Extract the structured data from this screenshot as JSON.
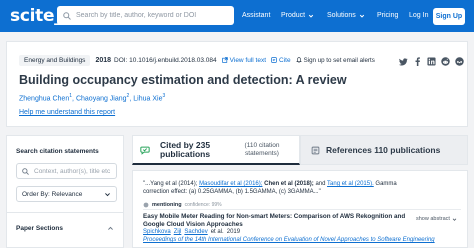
{
  "brand": {
    "logo": "scite_"
  },
  "search": {
    "placeholder": "Search by title, author, keyword or DOI"
  },
  "nav": {
    "assistant": "Assistant",
    "product": "Product",
    "solutions": "Solutions",
    "pricing": "Pricing",
    "login": "Log In",
    "signup": "Sign Up"
  },
  "paper": {
    "journal": "Energy and Buildings",
    "year": "2018",
    "doi": "DOI: 10.1016/j.enbuild.2018.03.084",
    "view_full_text": "View full text",
    "cite": "Cite",
    "alert": "Sign up to set email alerts",
    "share_icons": [
      "twitter-icon",
      "facebook-icon",
      "linkedin-icon",
      "reddit-icon",
      "mendeley-icon"
    ],
    "title": "Building occupancy estimation and detection: A review",
    "authors": [
      {
        "name": "Zhenghua Chen",
        "sup": "1"
      },
      {
        "name": "Chaoyang Jiang",
        "sup": "2"
      },
      {
        "name": "Lihua Xie",
        "sup": "3"
      }
    ],
    "help_link": "Help me understand this report"
  },
  "sidebar": {
    "heading": "Search citation statements",
    "search_placeholder": "Context, author(s), title etc",
    "order_by": "Order By: Relevance",
    "section_heading": "Paper Sections"
  },
  "citations": {
    "cited_by": "Cited by 235 publications",
    "statements": "(110 citation statements)",
    "references": "References 110 publications"
  },
  "statement": {
    "pre": "\"...Yang et al (2014);",
    "ref1": "Masoudifar et al (2016);",
    "highlight": "Chen et al (2018);",
    "mid": "and",
    "ref2": "Tang et al (2015).",
    "post": "Gamma correction effect: (a) 0.25GAMMA, (b) 1.5GAMMA, (c) 3GAMMA...\"",
    "mention_label": "mentioning",
    "confidence": "confidence: 99%",
    "title": "Easy Mobile Meter Reading for Non-smart Meters: Comparison of AWS Rekognition and Google Cloud Vision Approaches",
    "show_abstract": "show abstract",
    "authors": [
      "Spichkova",
      "Zijl",
      "Sachdev"
    ],
    "authors_suffix": "et al.",
    "year": "2019",
    "venue": "Proceedings of the 14th International Conference on Evaluation of Novel Approaches to Software Engineering"
  },
  "colors": {
    "primary": "#0d6fd1",
    "mentioning": "#9aa3ad",
    "cited_icon": "#27a35a"
  }
}
